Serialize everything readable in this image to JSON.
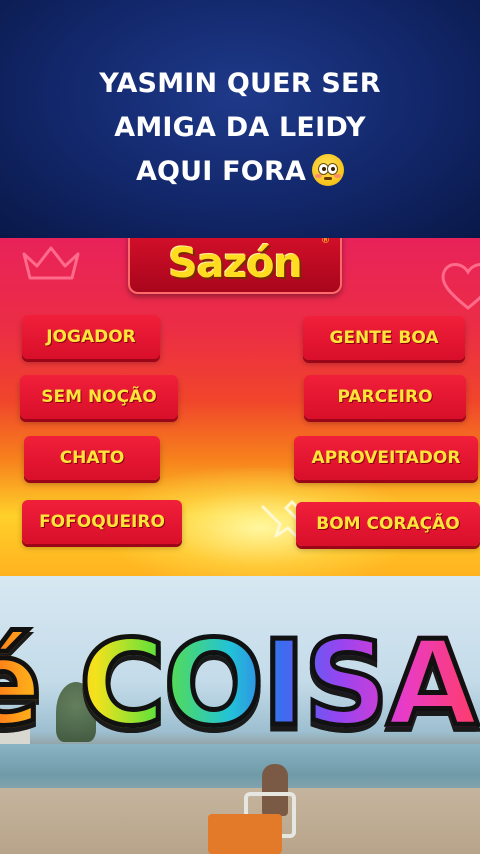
{
  "caption": {
    "lines": [
      "YASMIN QUER SER",
      "AMIGA DA LEIDY",
      "AQUI FORA"
    ],
    "emoji": "flushed-face-emoji"
  },
  "board": {
    "logo": "Sazón",
    "logo_mark": "®",
    "left_labels": [
      "JOGADOR",
      "SEM NOÇÃO",
      "CHATO",
      "FOFOQUEIRO"
    ],
    "right_labels": [
      "GENTE BOA",
      "PARCEIRO",
      "APROVEITADOR",
      "BOM CORAÇÃO"
    ],
    "colors": {
      "label_bg": "#e3142f",
      "label_text": "#ffe53a",
      "logo_bg": "#c00a22",
      "logo_text": "#ffdc20"
    }
  },
  "video": {
    "overlay_text": "é COISA"
  }
}
